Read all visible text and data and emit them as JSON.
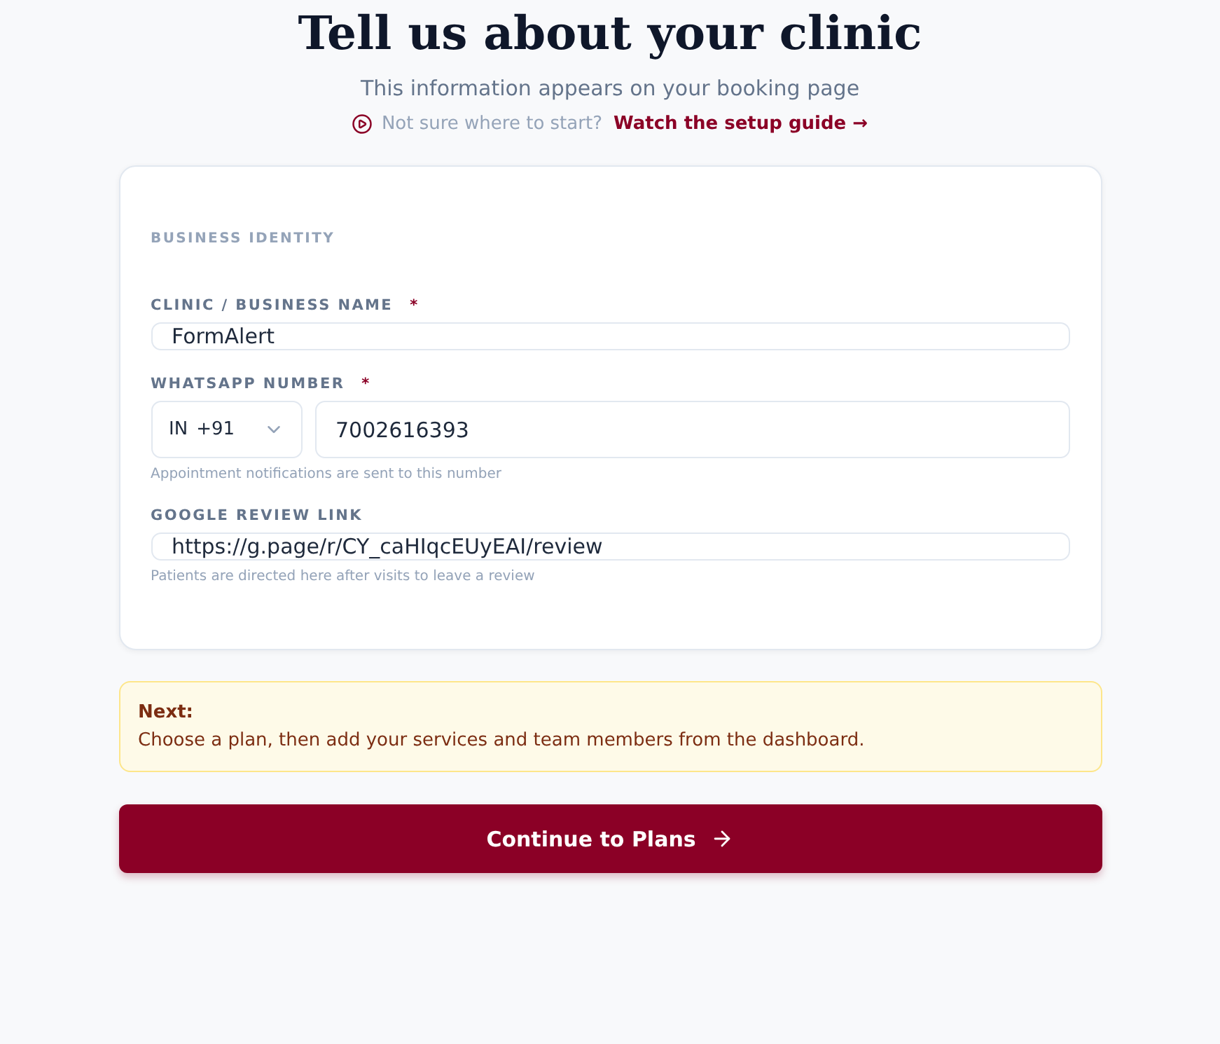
{
  "header": {
    "title": "Tell us about your clinic",
    "subtitle": "This information appears on your booking page",
    "help_prompt": "Not sure where to start?",
    "help_link": "Watch the setup guide →"
  },
  "card": {
    "section_title": "BUSINESS IDENTITY",
    "fields": [
      {
        "kind": "text",
        "label": "CLINIC / BUSINESS NAME",
        "required_mark": "*",
        "value": "FormAlert"
      },
      {
        "kind": "phone",
        "label": "WHATSAPP NUMBER",
        "required_mark": "*",
        "country": "IN",
        "dial_code": "+91",
        "value": "7002616393",
        "hint": "Appointment notifications are sent to this number"
      },
      {
        "kind": "text",
        "label": "GOOGLE REVIEW LINK",
        "value": "https://g.page/r/CY_caHIqcEUyEAI/review",
        "hint": "Patients are directed here after visits to leave a review"
      }
    ]
  },
  "notice": {
    "title": "Next:",
    "text": "Choose a plan, then add your services and team members from the dashboard."
  },
  "primary_button": {
    "label": "Continue to Plans"
  }
}
